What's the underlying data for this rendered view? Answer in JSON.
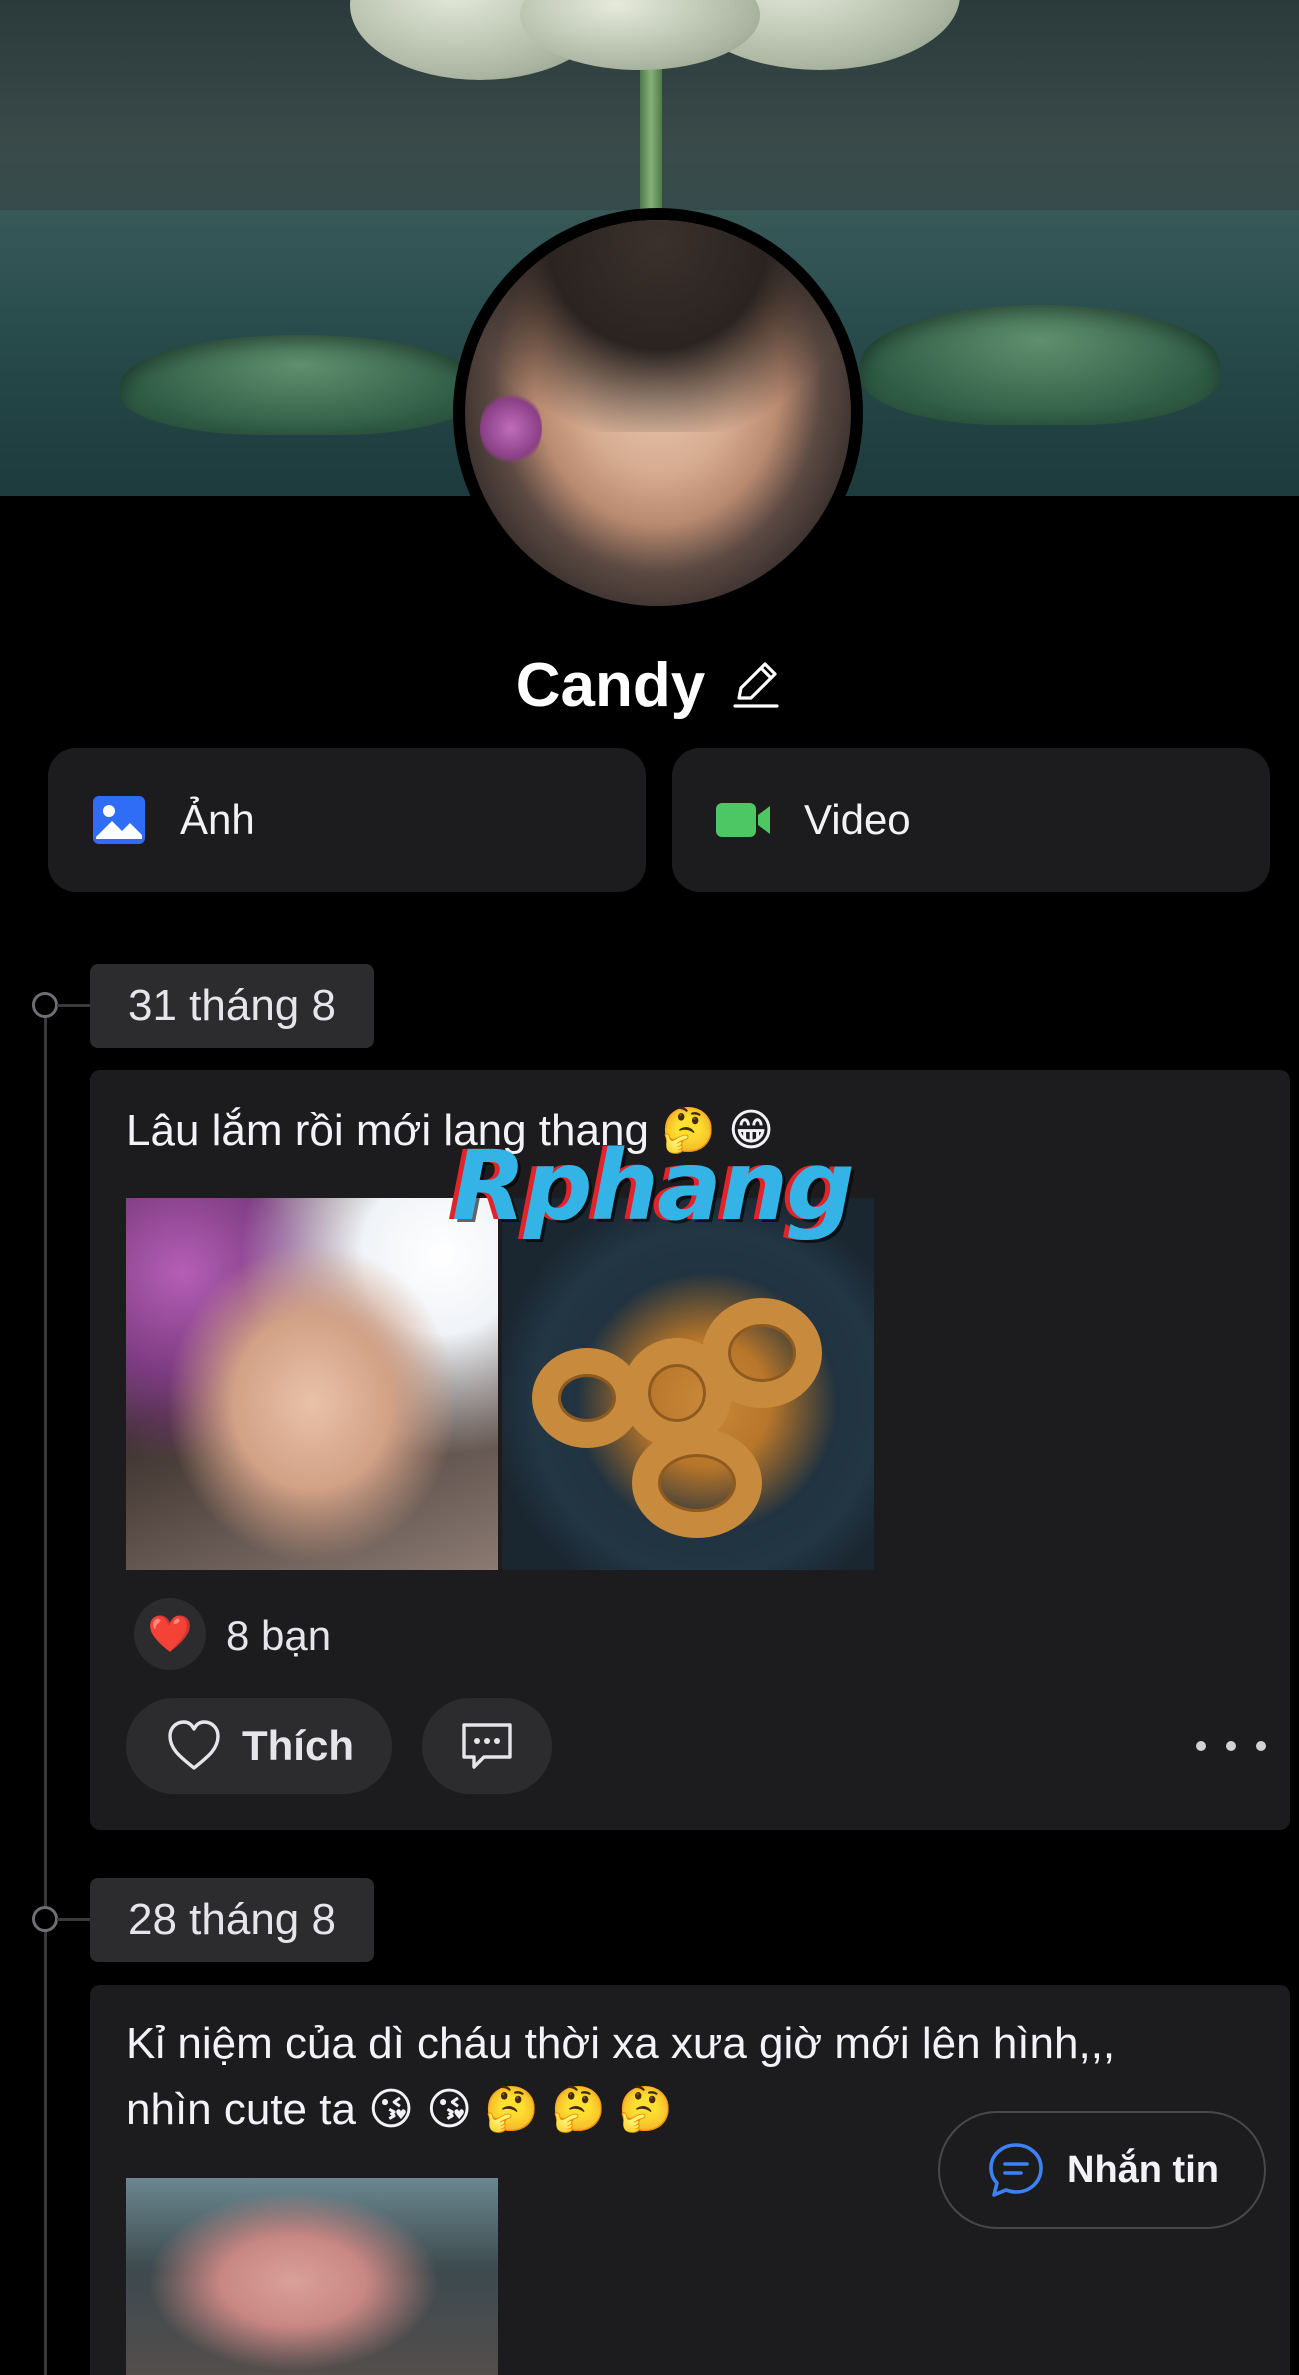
{
  "profile": {
    "name": "Candy"
  },
  "media_buttons": {
    "photo_label": "Ảnh",
    "video_label": "Video"
  },
  "posts": [
    {
      "date": "31 tháng 8",
      "text": "Lâu lắm rồi mới lang thang 🤔 😁",
      "reactions": {
        "emoji": "❤️",
        "count_label": "8 bạn"
      },
      "like_label": "Thích"
    },
    {
      "date": "28 tháng 8",
      "text_line1": "Kỉ niệm của dì cháu thời xa xưa giờ mới lên hình,,,",
      "text_line2": "nhìn cute ta 😘 😘 🤔 🤔 🤔"
    }
  ],
  "watermark": "Rphang",
  "floating": {
    "message_label": "Nhắn tin"
  },
  "colors": {
    "background": "#000000",
    "card": "#1c1c1e",
    "chip": "#2c2c2e",
    "photo_icon": "#2f6df6",
    "video_icon": "#4cc764",
    "message_icon": "#3b82f6",
    "heart": "#ff2d3f"
  },
  "icons": [
    "edit-icon",
    "photo-icon",
    "video-icon",
    "heart-icon",
    "comment-icon",
    "more-icon",
    "message-icon"
  ]
}
